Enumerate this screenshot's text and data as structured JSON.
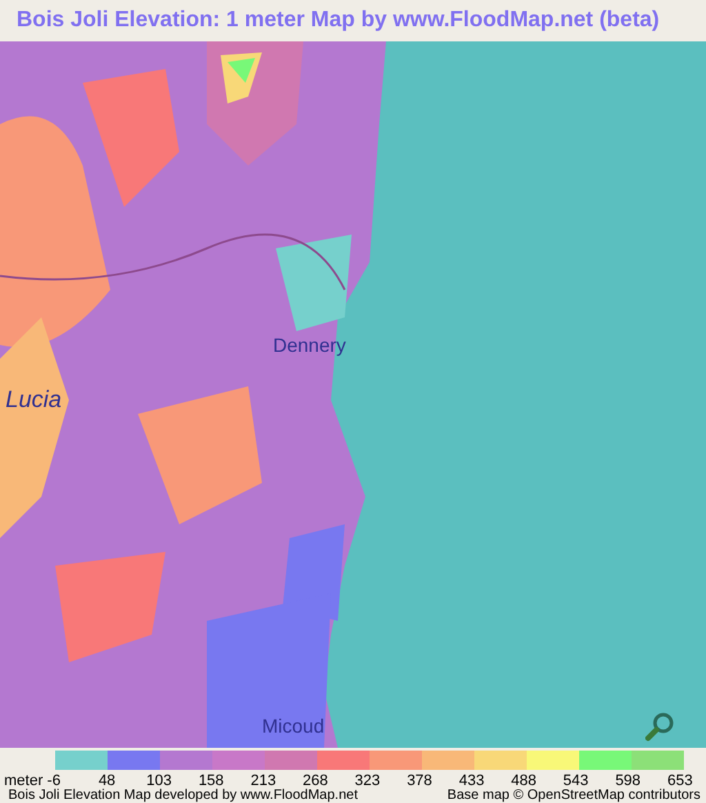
{
  "title": "Bois Joli Elevation: 1 meter Map by www.FloodMap.net (beta)",
  "map": {
    "places": [
      {
        "name": "Dennery",
        "kind": "town"
      },
      {
        "name": "Lucia",
        "kind": "region"
      },
      {
        "name": "Micoud",
        "kind": "town"
      }
    ]
  },
  "legend": {
    "swatches": [
      {
        "color": "#76d0cc"
      },
      {
        "color": "#7878f0"
      },
      {
        "color": "#b478d0"
      },
      {
        "color": "#c878c8"
      },
      {
        "color": "#d078b0"
      },
      {
        "color": "#f87878"
      },
      {
        "color": "#f89878"
      },
      {
        "color": "#f8b878"
      },
      {
        "color": "#f8d878"
      },
      {
        "color": "#f8f878"
      },
      {
        "color": "#78f878"
      },
      {
        "color": "#8ce078"
      }
    ],
    "ticks": [
      "meter -6",
      "48",
      "103",
      "158",
      "213",
      "268",
      "323",
      "378",
      "433",
      "488",
      "543",
      "598",
      "653"
    ]
  },
  "footer": {
    "left": "Bois Joli Elevation Map developed by www.FloodMap.net",
    "right": "Base map © OpenStreetMap contributors"
  }
}
